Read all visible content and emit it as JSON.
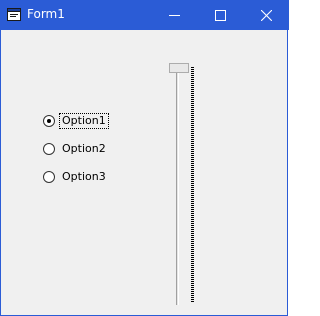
{
  "window": {
    "title": "Form1",
    "icon": "form-app-icon",
    "buttons": {
      "minimize": "minimize-icon",
      "maximize": "maximize-icon",
      "close": "close-icon"
    },
    "colors": {
      "titlebar": "#2b5cd6",
      "client": "#f0f0f0"
    }
  },
  "options": {
    "items": [
      {
        "label": "Option1",
        "checked": true,
        "focused": true
      },
      {
        "label": "Option2",
        "checked": false,
        "focused": false
      },
      {
        "label": "Option3",
        "checked": false,
        "focused": false
      }
    ]
  },
  "slider": {
    "orientation": "vertical",
    "value_position": "top"
  }
}
